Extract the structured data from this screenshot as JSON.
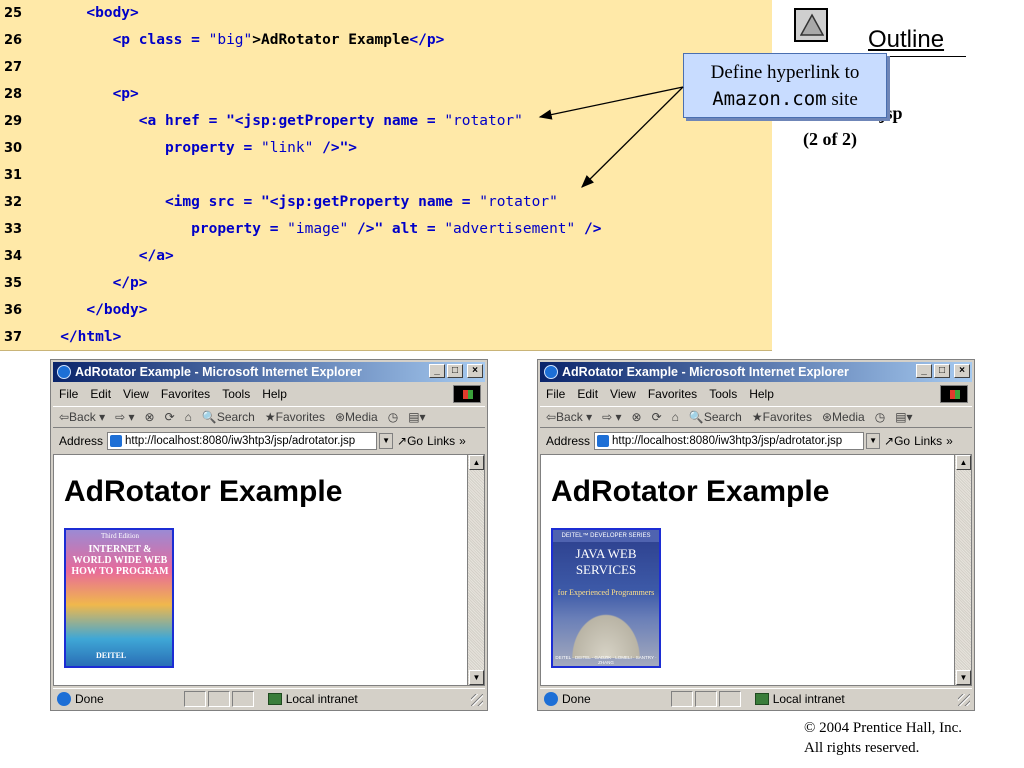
{
  "code_lines": [
    {
      "num": "25",
      "tokens": [
        {
          "t": "      <body>",
          "c": "blue"
        }
      ]
    },
    {
      "num": "26",
      "tokens": [
        {
          "t": "         <p class = ",
          "c": "blue"
        },
        {
          "t": "\"big\"",
          "c": "str"
        },
        {
          "t": ">AdRotator Example",
          "c": "black"
        },
        {
          "t": "</p>",
          "c": "blue"
        }
      ]
    },
    {
      "num": "27",
      "tokens": []
    },
    {
      "num": "28",
      "tokens": [
        {
          "t": "         <p>",
          "c": "blue"
        }
      ]
    },
    {
      "num": "29",
      "tokens": [
        {
          "t": "            <a href = ",
          "c": "blue"
        },
        {
          "t": "\"<jsp:getProperty name = ",
          "c": "blue"
        },
        {
          "t": "\"rotator\"",
          "c": "str"
        }
      ]
    },
    {
      "num": "30",
      "tokens": [
        {
          "t": "               property = ",
          "c": "blue"
        },
        {
          "t": "\"link\"",
          "c": "str"
        },
        {
          "t": " />\">",
          "c": "blue"
        }
      ]
    },
    {
      "num": "31",
      "tokens": []
    },
    {
      "num": "32",
      "tokens": [
        {
          "t": "               <img src = ",
          "c": "blue"
        },
        {
          "t": "\"<jsp:getProperty name = ",
          "c": "blue"
        },
        {
          "t": "\"rotator\"",
          "c": "str"
        }
      ]
    },
    {
      "num": "33",
      "tokens": [
        {
          "t": "                  property = ",
          "c": "blue"
        },
        {
          "t": "\"image\"",
          "c": "str"
        },
        {
          "t": " />\" alt = ",
          "c": "blue"
        },
        {
          "t": "\"advertisement\"",
          "c": "str"
        },
        {
          "t": " />",
          "c": "blue"
        }
      ]
    },
    {
      "num": "34",
      "tokens": [
        {
          "t": "            </a>",
          "c": "blue"
        }
      ]
    },
    {
      "num": "35",
      "tokens": [
        {
          "t": "         </p>",
          "c": "blue"
        }
      ]
    },
    {
      "num": "36",
      "tokens": [
        {
          "t": "      </body>",
          "c": "blue"
        }
      ]
    },
    {
      "num": "37",
      "tokens": [
        {
          "t": "   </html>",
          "c": "blue"
        }
      ]
    }
  ],
  "outline": {
    "label": "Outline",
    "file_name": "adrotator.jsp",
    "file_part": "(2 of 2)",
    "nav_icon": "up-triangle-icon"
  },
  "callout": {
    "line1": "Define hyperlink to",
    "site_mono": "Amazon.com",
    "site_suffix": " site"
  },
  "browsers": [
    {
      "title": "AdRotator Example - Microsoft Internet Explorer",
      "menu": [
        "File",
        "Edit",
        "View",
        "Favorites",
        "Tools",
        "Help"
      ],
      "toolbar": [
        "⇦Back ▾",
        "⇨ ▾",
        "⊗",
        "⟳",
        "⌂",
        "🔍Search",
        "★Favorites",
        "⊛Media",
        "◷",
        "▤▾"
      ],
      "address_label": "Address",
      "address_url": "http://localhost:8080/iw3htp3/jsp/adrotator.jsp",
      "go_label": "Go",
      "links_label": "Links",
      "heading": "AdRotator Example",
      "ad": {
        "kind": "book1",
        "sub": "Third Edition",
        "title": "INTERNET & WORLD WIDE WEB HOW TO PROGRAM",
        "author": "DEITEL"
      },
      "status_text": "Done",
      "zone_text": "Local intranet"
    },
    {
      "title": "AdRotator Example - Microsoft Internet Explorer",
      "menu": [
        "File",
        "Edit",
        "View",
        "Favorites",
        "Tools",
        "Help"
      ],
      "toolbar": [
        "⇦Back ▾",
        "⇨ ▾",
        "⊗",
        "⟳",
        "⌂",
        "🔍Search",
        "★Favorites",
        "⊛Media",
        "◷",
        "▤▾"
      ],
      "address_label": "Address",
      "address_url": "http://localhost:8080/iw3htp3/jsp/adrotator.jsp",
      "go_label": "Go",
      "links_label": "Links",
      "heading": "AdRotator Example",
      "ad": {
        "kind": "book2",
        "series": "DEITEL™ DEVELOPER SERIES",
        "title": "JAVA WEB SERVICES",
        "sub": "for Experienced Programmers",
        "authors": "DEITEL · DEITEL · GADZIK · LOMELI · SANTRY · ZHANG"
      },
      "status_text": "Done",
      "zone_text": "Local intranet"
    }
  ],
  "copyright": {
    "line1": "© 2004 Prentice Hall, Inc.",
    "line2": "All rights reserved."
  },
  "colors": {
    "code_bg": "#ffe9a8",
    "code_keyword": "#0000c8",
    "callout_bg": "#c8dcff",
    "ie_title_start": "#0a246a",
    "ie_title_end": "#a6caf0"
  }
}
